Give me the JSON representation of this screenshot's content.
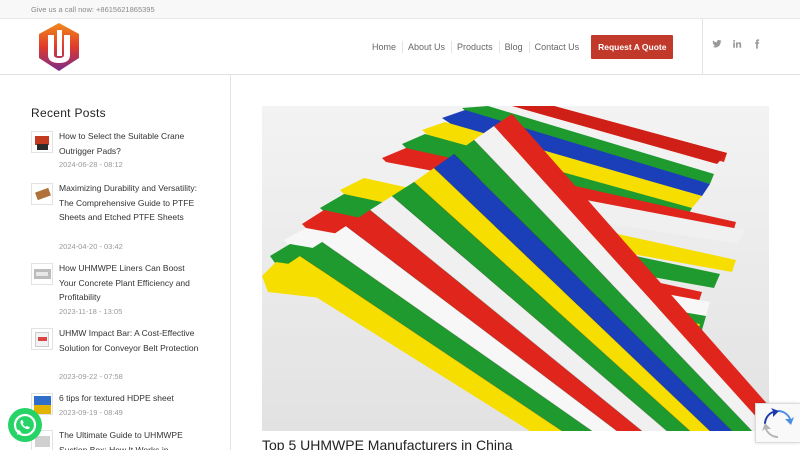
{
  "topbar": {
    "call_text": "Give us a call now: +8615621865395"
  },
  "nav": {
    "items": [
      "Home",
      "About Us",
      "Products",
      "Blog",
      "Contact Us"
    ],
    "quote_label": "Request A Quote"
  },
  "social": [
    "twitter-icon",
    "linkedin-icon",
    "facebook-icon"
  ],
  "sidebar": {
    "title": "Recent Posts",
    "posts": [
      {
        "title": "How to Select the Suitable Crane Outrigger Pads?",
        "date": "2024-06-28 - 08:12"
      },
      {
        "title": "Maximizing Durability and Versatility: The Comprehensive Guide to PTFE Sheets and Etched PTFE Sheets",
        "date": "2024-04-20 - 03:42"
      },
      {
        "title": "How UHMWPE Liners Can Boost Your Concrete Plant Efficiency and Profitability",
        "date": "2023-11-18 - 13:05"
      },
      {
        "title": "UHMW Impact Bar: A Cost-Effective Solution for Conveyor Belt Protection",
        "date": "2023-09-22 - 07:58"
      },
      {
        "title": "6 tips for textured HDPE sheet",
        "date": "2023-09-19 - 08:49"
      },
      {
        "title": "The Ultimate Guide to UHMWPE Suction Box: How It Works in",
        "date": ""
      }
    ]
  },
  "article": {
    "title": "Top 5 UHMWPE Manufacturers in China"
  },
  "colors": {
    "accent": "#c0392b",
    "whatsapp": "#25d366",
    "sheet_red": "#e0261c",
    "sheet_green": "#1f9a2e",
    "sheet_yellow": "#f6de00",
    "sheet_blue": "#1a3fb8",
    "sheet_white": "#f7f7f7"
  }
}
